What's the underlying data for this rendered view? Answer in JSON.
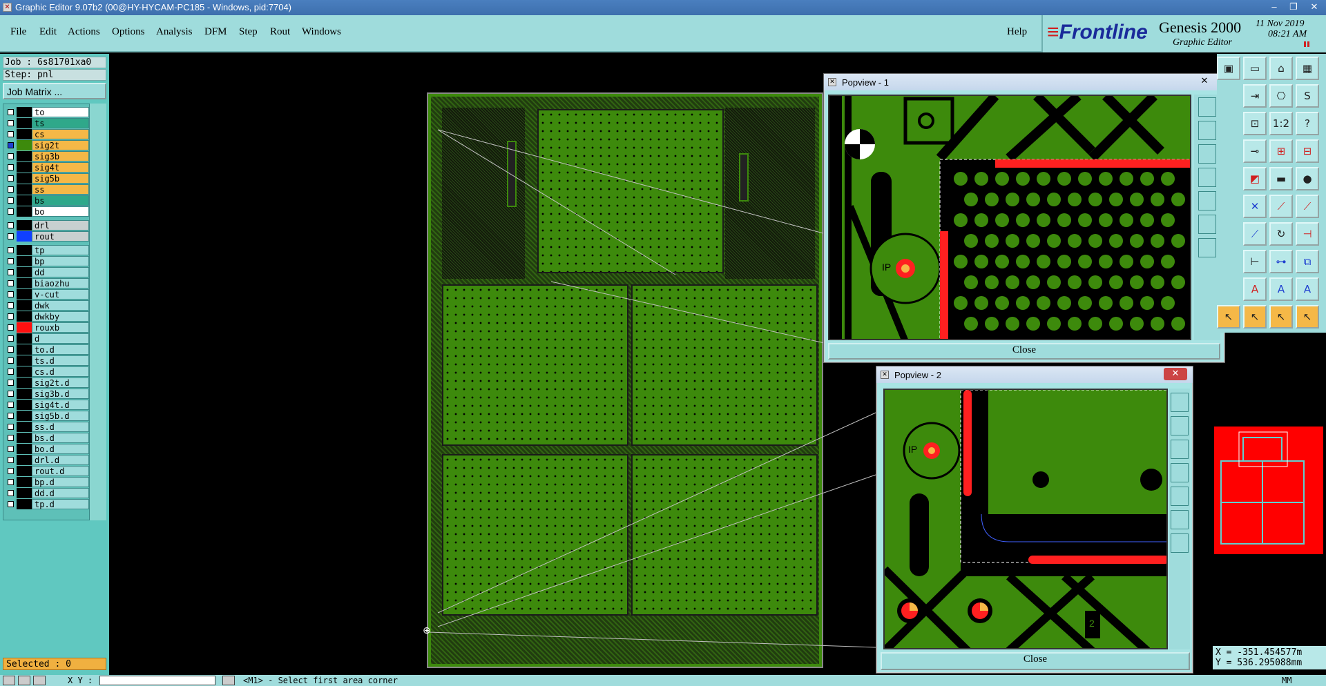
{
  "window": {
    "title": "Graphic Editor 9.07b2 (00@HY-HYCAM-PC185 - Windows, pid:7704)",
    "icon": "x-app-icon"
  },
  "menu": {
    "items": [
      "File",
      "Edit",
      "Actions",
      "Options",
      "Analysis",
      "DFM",
      "Step",
      "Rout",
      "Windows"
    ],
    "help": "Help"
  },
  "brand": {
    "logo": "Frontline",
    "product": "Genesis 2000",
    "subtitle": "Graphic Editor",
    "date": "11 Nov 2019",
    "time": "08:21 AM"
  },
  "job": {
    "job_line": "Job : 6s81701xa0",
    "step_line": "Step: pnl",
    "matrix_button": "Job Matrix ..."
  },
  "layers": [
    {
      "name": "to",
      "color": "#ffffff",
      "swatch": "#000000"
    },
    {
      "name": "ts",
      "color": "#2fa88a",
      "swatch": "#000000"
    },
    {
      "name": "cs",
      "color": "#f5b847",
      "swatch": "#000000"
    },
    {
      "name": "sig2t",
      "color": "#f5b847",
      "swatch": "#3d8a0c",
      "active": true
    },
    {
      "name": "sig3b",
      "color": "#f5b847",
      "swatch": "#000000"
    },
    {
      "name": "sig4t",
      "color": "#f5b847",
      "swatch": "#000000"
    },
    {
      "name": "sig5b",
      "color": "#f5b847",
      "swatch": "#000000"
    },
    {
      "name": "ss",
      "color": "#f5b847",
      "swatch": "#000000"
    },
    {
      "name": "bs",
      "color": "#2fa88a",
      "swatch": "#000000"
    },
    {
      "name": "bo",
      "color": "#ffffff",
      "swatch": "#000000"
    },
    {
      "name": "drl",
      "color": "#c8d0d0",
      "swatch": "#000000"
    },
    {
      "name": "rout",
      "color": "#c8d0d0",
      "swatch": "#1040ff"
    },
    {
      "name": "tp",
      "color": "#9fdcdc",
      "swatch": "#000000"
    },
    {
      "name": "bp",
      "color": "#9fdcdc",
      "swatch": "#000000"
    },
    {
      "name": "dd",
      "color": "#9fdcdc",
      "swatch": "#000000"
    },
    {
      "name": "biaozhu",
      "color": "#9fdcdc",
      "swatch": "#000000"
    },
    {
      "name": "v-cut",
      "color": "#9fdcdc",
      "swatch": "#000000"
    },
    {
      "name": "dwk",
      "color": "#9fdcdc",
      "swatch": "#000000"
    },
    {
      "name": "dwkby",
      "color": "#9fdcdc",
      "swatch": "#000000"
    },
    {
      "name": "rouxb",
      "color": "#9fdcdc",
      "swatch": "#ff1010"
    },
    {
      "name": "d",
      "color": "#9fdcdc",
      "swatch": "#000000"
    },
    {
      "name": "to.d",
      "color": "#9fdcdc",
      "swatch": "#000000"
    },
    {
      "name": "ts.d",
      "color": "#9fdcdc",
      "swatch": "#000000"
    },
    {
      "name": "cs.d",
      "color": "#9fdcdc",
      "swatch": "#000000"
    },
    {
      "name": "sig2t.d",
      "color": "#9fdcdc",
      "swatch": "#000000"
    },
    {
      "name": "sig3b.d",
      "color": "#9fdcdc",
      "swatch": "#000000"
    },
    {
      "name": "sig4t.d",
      "color": "#9fdcdc",
      "swatch": "#000000"
    },
    {
      "name": "sig5b.d",
      "color": "#9fdcdc",
      "swatch": "#000000"
    },
    {
      "name": "ss.d",
      "color": "#9fdcdc",
      "swatch": "#000000"
    },
    {
      "name": "bs.d",
      "color": "#9fdcdc",
      "swatch": "#000000"
    },
    {
      "name": "bo.d",
      "color": "#9fdcdc",
      "swatch": "#000000"
    },
    {
      "name": "drl.d",
      "color": "#9fdcdc",
      "swatch": "#000000"
    },
    {
      "name": "rout.d",
      "color": "#9fdcdc",
      "swatch": "#000000"
    },
    {
      "name": "bp.d",
      "color": "#9fdcdc",
      "swatch": "#000000"
    },
    {
      "name": "dd.d",
      "color": "#9fdcdc",
      "swatch": "#000000"
    },
    {
      "name": "tp.d",
      "color": "#9fdcdc",
      "swatch": "#000000"
    }
  ],
  "popview1": {
    "title": "Popview - 1",
    "close": "Close",
    "label": "IP"
  },
  "popview2": {
    "title": "Popview - 2",
    "close": "Close",
    "label": "IP",
    "marker": "2"
  },
  "coords": {
    "x": "X = -351.454577m",
    "y": "Y = 536.295088mm"
  },
  "selected": "Selected : 0",
  "status": {
    "xy_label": "X Y :",
    "message": "<M1> - Select first area corner",
    "unit": "MM"
  },
  "colors": {
    "copper": "#3d8a0c",
    "panel_bg": "#9fdcdc",
    "highlight": "#ff1010"
  }
}
